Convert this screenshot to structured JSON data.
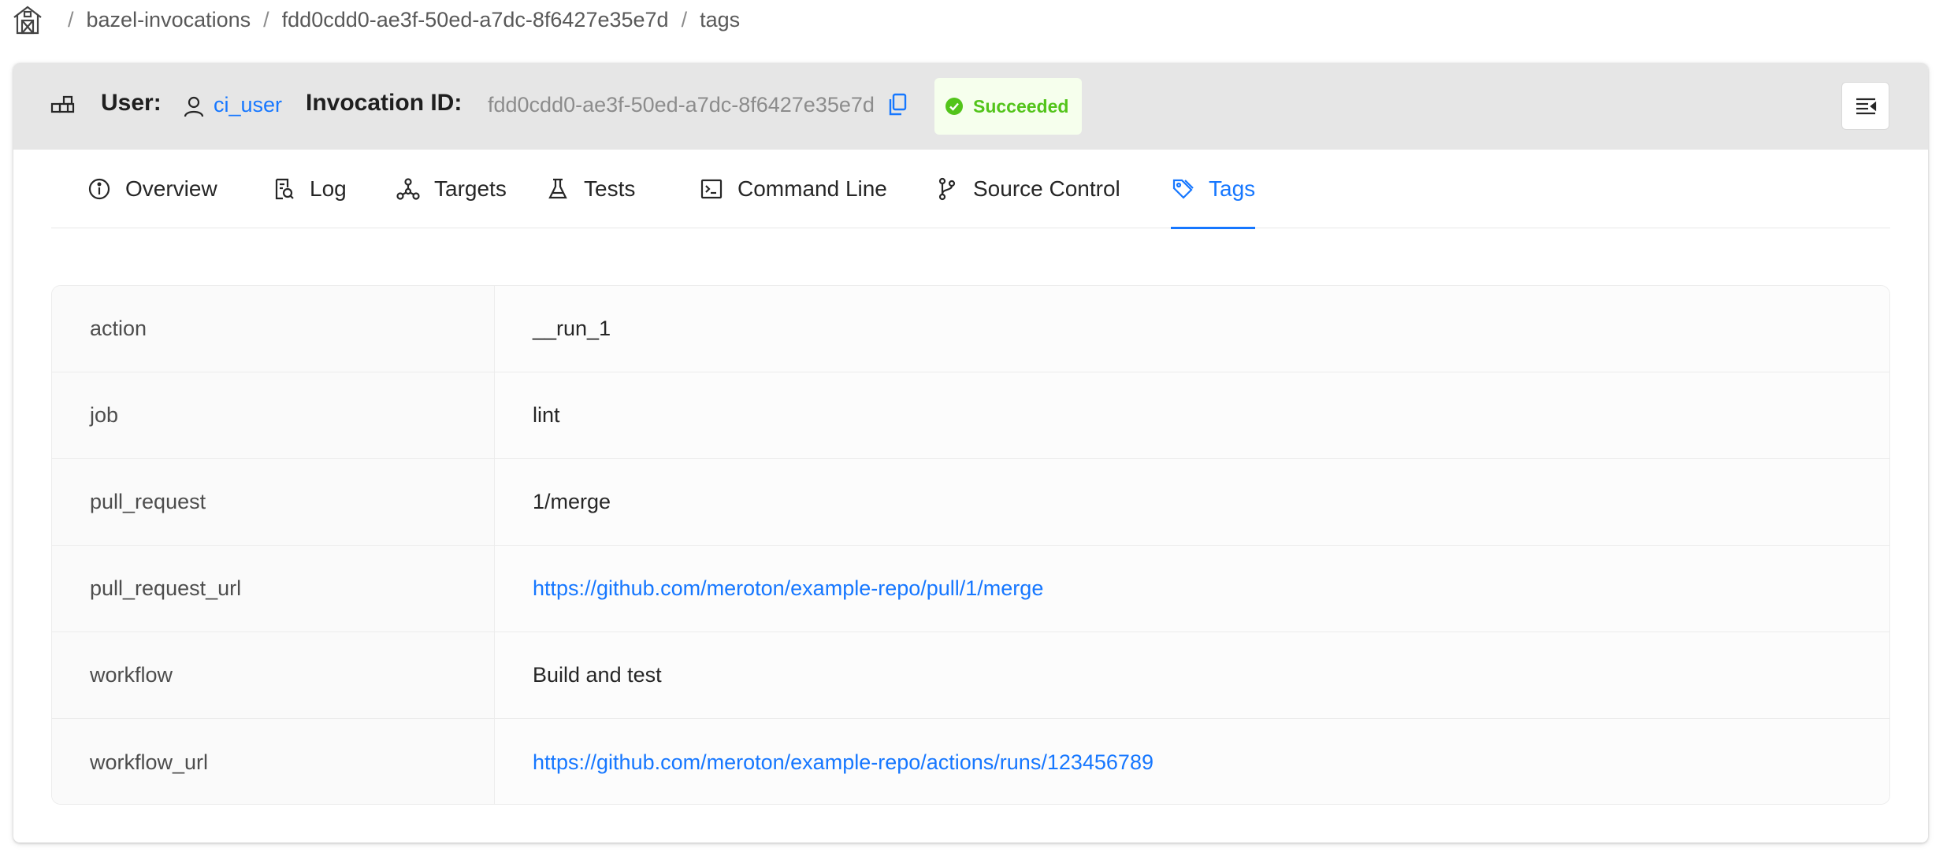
{
  "breadcrumb": {
    "items": [
      "bazel-invocations",
      "fdd0cdd0-ae3f-50ed-a7dc-8f6427e35e7d",
      "tags"
    ],
    "separator": "/"
  },
  "header": {
    "user_label": "User:",
    "user_value": "ci_user",
    "invocation_label": "Invocation ID:",
    "invocation_value": "fdd0cdd0-ae3f-50ed-a7dc-8f6427e35e7d",
    "status": "Succeeded",
    "status_color": "#52c41a"
  },
  "tabs": [
    {
      "label": "Overview",
      "icon": "info-circle-icon"
    },
    {
      "label": "Log",
      "icon": "file-search-icon"
    },
    {
      "label": "Targets",
      "icon": "deployment-unit-icon"
    },
    {
      "label": "Tests",
      "icon": "experiment-icon"
    },
    {
      "label": "Command Line",
      "icon": "code-icon"
    },
    {
      "label": "Source Control",
      "icon": "branches-icon"
    },
    {
      "label": "Tags",
      "icon": "tags-icon",
      "active": true
    }
  ],
  "tags": [
    {
      "key": "action",
      "value": "__run_1",
      "link": false
    },
    {
      "key": "job",
      "value": "lint",
      "link": false
    },
    {
      "key": "pull_request",
      "value": "1/merge",
      "link": false
    },
    {
      "key": "pull_request_url",
      "value": "https://github.com/meroton/example-repo/pull/1/merge",
      "link": true
    },
    {
      "key": "workflow",
      "value": "Build and test",
      "link": false
    },
    {
      "key": "workflow_url",
      "value": "https://github.com/meroton/example-repo/actions/runs/123456789",
      "link": true
    }
  ],
  "colors": {
    "accent": "#1677ff",
    "success": "#52c41a",
    "header_bg": "#e6e6e6"
  }
}
